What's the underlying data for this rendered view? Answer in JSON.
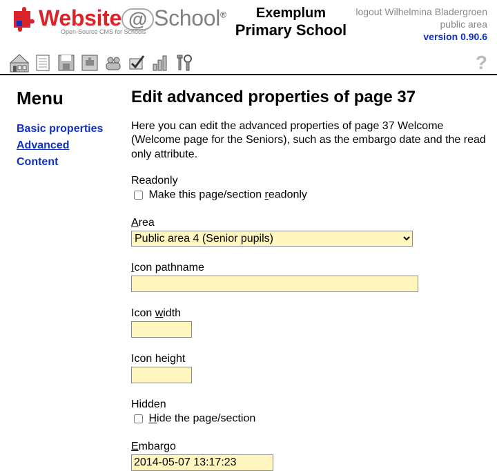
{
  "header": {
    "logo": {
      "w": "Website",
      "at": "@",
      "s": "School",
      "reg": "®",
      "sub": "Open-Source CMS for Schools"
    },
    "title": {
      "line1": "Exemplum",
      "line2": "Primary School"
    },
    "topright": {
      "logout": "logout Wilhelmina Bladergroen",
      "area": "public area",
      "version": "version 0.90.6"
    }
  },
  "sidebar": {
    "heading": "Menu",
    "items": [
      {
        "label": "Basic properties"
      },
      {
        "label": "Advanced"
      },
      {
        "label": "Content"
      }
    ]
  },
  "content": {
    "heading": "Edit advanced properties of page 37",
    "intro": "Here you can edit the advanced properties of page 37 Welcome (Welcome page for the Seniors), such as the embargo date and the read only attribute.",
    "readonly": {
      "label": "Readonly",
      "chk_pre": "Make this page/section ",
      "chk_u": "r",
      "chk_post": "eadonly"
    },
    "area": {
      "label_u": "A",
      "label_post": "rea",
      "value": "Public area 4 (Senior pupils)"
    },
    "icon_path": {
      "label_u": "I",
      "label_post": "con pathname",
      "value": ""
    },
    "icon_width": {
      "label_pre": "Icon ",
      "label_u": "w",
      "label_post": "idth",
      "value": ""
    },
    "icon_height": {
      "label_pre": "Icon hei",
      "label_u": "g",
      "label_post": "ht",
      "value": ""
    },
    "hidden": {
      "label": "Hidden",
      "chk_u": "H",
      "chk_post": "ide the page/section"
    },
    "embargo": {
      "label_u": "E",
      "label_post": "mbargo",
      "value": "2014-05-07 13:17:23"
    }
  }
}
